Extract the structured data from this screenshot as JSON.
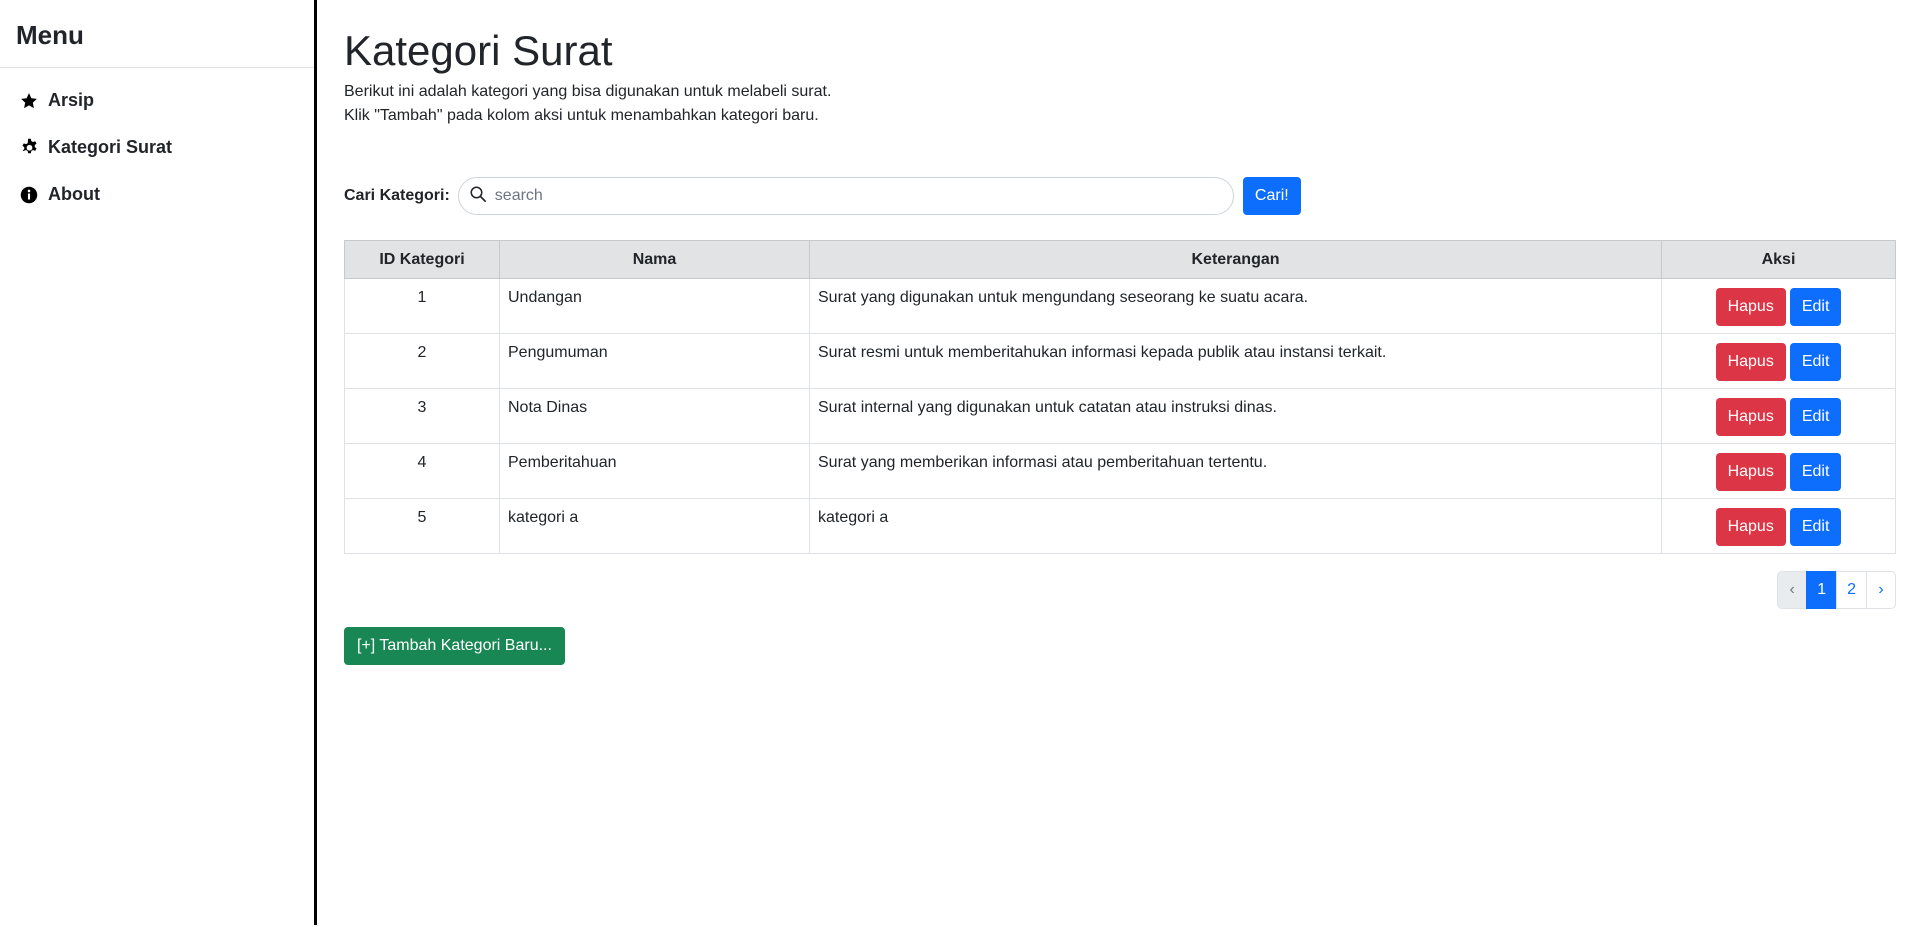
{
  "sidebar": {
    "title": "Menu",
    "items": [
      {
        "label": "Arsip",
        "icon": "star-icon"
      },
      {
        "label": "Kategori Surat",
        "icon": "gear-icon"
      },
      {
        "label": "About",
        "icon": "info-icon"
      }
    ]
  },
  "main": {
    "title": "Kategori Surat",
    "desc_line1": "Berikut ini adalah kategori yang bisa digunakan untuk melabeli surat.",
    "desc_line2": "Klik \"Tambah\" pada kolom aksi untuk menambahkan kategori baru."
  },
  "search": {
    "label": "Cari Kategori:",
    "placeholder": "search",
    "value": "",
    "button": "Cari!"
  },
  "table": {
    "headers": [
      "ID Kategori",
      "Nama",
      "Keterangan",
      "Aksi"
    ],
    "rows": [
      {
        "id": "1",
        "nama": "Undangan",
        "keterangan": "Surat yang digunakan untuk mengundang seseorang ke suatu acara."
      },
      {
        "id": "2",
        "nama": "Pengumuman",
        "keterangan": "Surat resmi untuk memberitahukan informasi kepada publik atau instansi terkait."
      },
      {
        "id": "3",
        "nama": "Nota Dinas",
        "keterangan": "Surat internal yang digunakan untuk catatan atau instruksi dinas."
      },
      {
        "id": "4",
        "nama": "Pemberitahuan",
        "keterangan": "Surat yang memberikan informasi atau pemberitahuan tertentu."
      },
      {
        "id": "5",
        "nama": "kategori a",
        "keterangan": "kategori a"
      }
    ],
    "delete_label": "Hapus",
    "edit_label": "Edit"
  },
  "pagination": {
    "prev": "‹",
    "pages": [
      "1",
      "2"
    ],
    "current": "1",
    "next": "›"
  },
  "add_button": "[+] Tambah Kategori Baru...",
  "colors": {
    "primary": "#0d6efd",
    "danger": "#dc3545",
    "success": "#198754",
    "header_bg": "#e2e3e5"
  }
}
